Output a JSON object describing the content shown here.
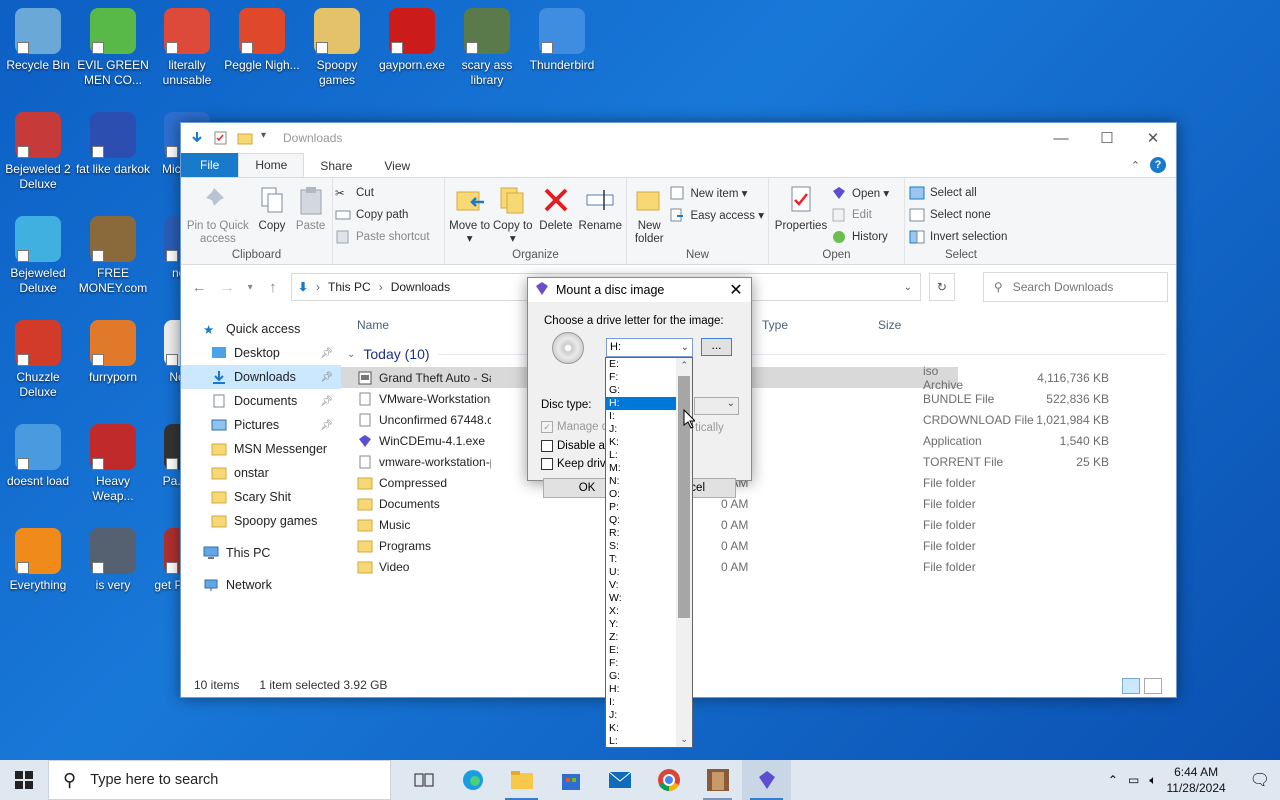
{
  "desktop": {
    "icons": [
      {
        "label": "Recycle Bin",
        "color": "#6aa8d8"
      },
      {
        "label": "EVIL GREEN MEN CO...",
        "color": "#58b848"
      },
      {
        "label": "literally unusable",
        "color": "#dd4a3a"
      },
      {
        "label": "Peggle Nigh...",
        "color": "#e0482c"
      },
      {
        "label": "Spoopy games",
        "color": "#e4c26a"
      },
      {
        "label": "gayporn.exe",
        "color": "#cc1b1b"
      },
      {
        "label": "scary ass library",
        "color": "#5b7a4b"
      },
      {
        "label": "Thunderbird",
        "color": "#3f8de0"
      },
      {
        "label": "Bejeweled 2 Deluxe",
        "color": "#c63a3a"
      },
      {
        "label": "fat like darkok",
        "color": "#2b4eb0"
      },
      {
        "label": "Mic... E...",
        "color": "#2d6fd0"
      },
      {
        "label": "Bejeweled Deluxe",
        "color": "#3fb0e0"
      },
      {
        "label": "FREE MONEY.com",
        "color": "#8a6a3a"
      },
      {
        "label": "nep...",
        "color": "#2a5fb8"
      },
      {
        "label": "Chuzzle Deluxe",
        "color": "#d23a2a"
      },
      {
        "label": "furryporn",
        "color": "#e07a2a"
      },
      {
        "label": "Note...",
        "color": "#eeeeee"
      },
      {
        "label": "doesnt load",
        "color": "#4a9ae0"
      },
      {
        "label": "Heavy Weap...",
        "color": "#c02a2a"
      },
      {
        "label": "Pa... Pl...",
        "color": "#333333"
      },
      {
        "label": "Everything",
        "color": "#f08a1a"
      },
      {
        "label": "is very",
        "color": "#556070"
      },
      {
        "label": "get P... De...",
        "color": "#b03030"
      }
    ]
  },
  "explorer": {
    "title": "Downloads",
    "ribbon_tabs": [
      "File",
      "Home",
      "Share",
      "View"
    ],
    "clipboard": {
      "pin": "Pin to Quick access",
      "copy": "Copy",
      "paste": "Paste",
      "cut": "Cut",
      "copy_path": "Copy path",
      "paste_shortcut": "Paste shortcut",
      "label": "Clipboard"
    },
    "organize": {
      "move_to": "Move to ▾",
      "copy_to": "Copy to ▾",
      "delete": "Delete",
      "rename": "Rename",
      "label": "Organize"
    },
    "new": {
      "new_folder": "New folder",
      "new_item": "New item ▾",
      "easy_access": "Easy access ▾",
      "label": "New"
    },
    "open": {
      "properties": "Properties",
      "open": "Open ▾",
      "edit": "Edit",
      "history": "History",
      "label": "Open"
    },
    "select": {
      "select_all": "Select all",
      "select_none": "Select none",
      "invert": "Invert selection",
      "label": "Select"
    },
    "address": {
      "root": "This PC",
      "sep": "›",
      "folder": "Downloads"
    },
    "search_placeholder": "Search Downloads",
    "nav": {
      "quick_access": "Quick access",
      "items": [
        "Desktop",
        "Downloads",
        "Documents",
        "Pictures",
        "MSN Messenger",
        "onstar",
        "Scary Shit",
        "Spoopy games"
      ],
      "this_pc": "This PC",
      "network": "Network"
    },
    "columns": {
      "name": "Name",
      "type": "Type",
      "size": "Size"
    },
    "group_label": "Today (10)",
    "files": [
      {
        "name": "Grand Theft Auto - San Andr",
        "date": "",
        "type": "iso Archive",
        "size": "4,116,736 KB"
      },
      {
        "name": "VMware-Workstation-Full-17",
        "date": "",
        "type": "BUNDLE File",
        "size": "522,836 KB"
      },
      {
        "name": "Unconfirmed 67448.crdownl",
        "date": "",
        "type": "CRDOWNLOAD File",
        "size": "1,021,984 KB"
      },
      {
        "name": "WinCDEmu-4.1.exe",
        "date": "",
        "type": "Application",
        "size": "1,540 KB"
      },
      {
        "name": "vmware-workstation-pro-17",
        "date": "",
        "type": "TORRENT File",
        "size": "25 KB"
      },
      {
        "name": "Compressed",
        "date": "0 AM",
        "type": "File folder",
        "size": ""
      },
      {
        "name": "Documents",
        "date": "0 AM",
        "type": "File folder",
        "size": ""
      },
      {
        "name": "Music",
        "date": "0 AM",
        "type": "File folder",
        "size": ""
      },
      {
        "name": "Programs",
        "date": "0 AM",
        "type": "File folder",
        "size": ""
      },
      {
        "name": "Video",
        "date": "0 AM",
        "type": "File folder",
        "size": ""
      }
    ],
    "status": {
      "count": "10 items",
      "selected": "1 item selected  3.92 GB"
    }
  },
  "dialog": {
    "title": "Mount a disc image",
    "prompt": "Choose a drive letter for the image:",
    "selected_drive": "H:",
    "browse": "...",
    "disc_type_label": "Disc type:",
    "manage_label": "Manage d",
    "manage_suffix": "tically",
    "disable_label": "Disable au",
    "keep_label": "Keep drive",
    "ok": "OK",
    "cancel": "cel"
  },
  "droplist": {
    "items": [
      "E:",
      "F:",
      "G:",
      "H:",
      "I:",
      "J:",
      "K:",
      "L:",
      "M:",
      "N:",
      "O:",
      "P:",
      "Q:",
      "R:",
      "S:",
      "T:",
      "U:",
      "V:",
      "W:",
      "X:",
      "Y:",
      "Z:",
      "E:",
      "F:",
      "G:",
      "H:",
      "I:",
      "J:",
      "K:",
      "L:"
    ],
    "highlighted_index": 3
  },
  "taskbar": {
    "search_placeholder": "Type here to search",
    "time": "6:44 AM",
    "date": "11/28/2024"
  }
}
